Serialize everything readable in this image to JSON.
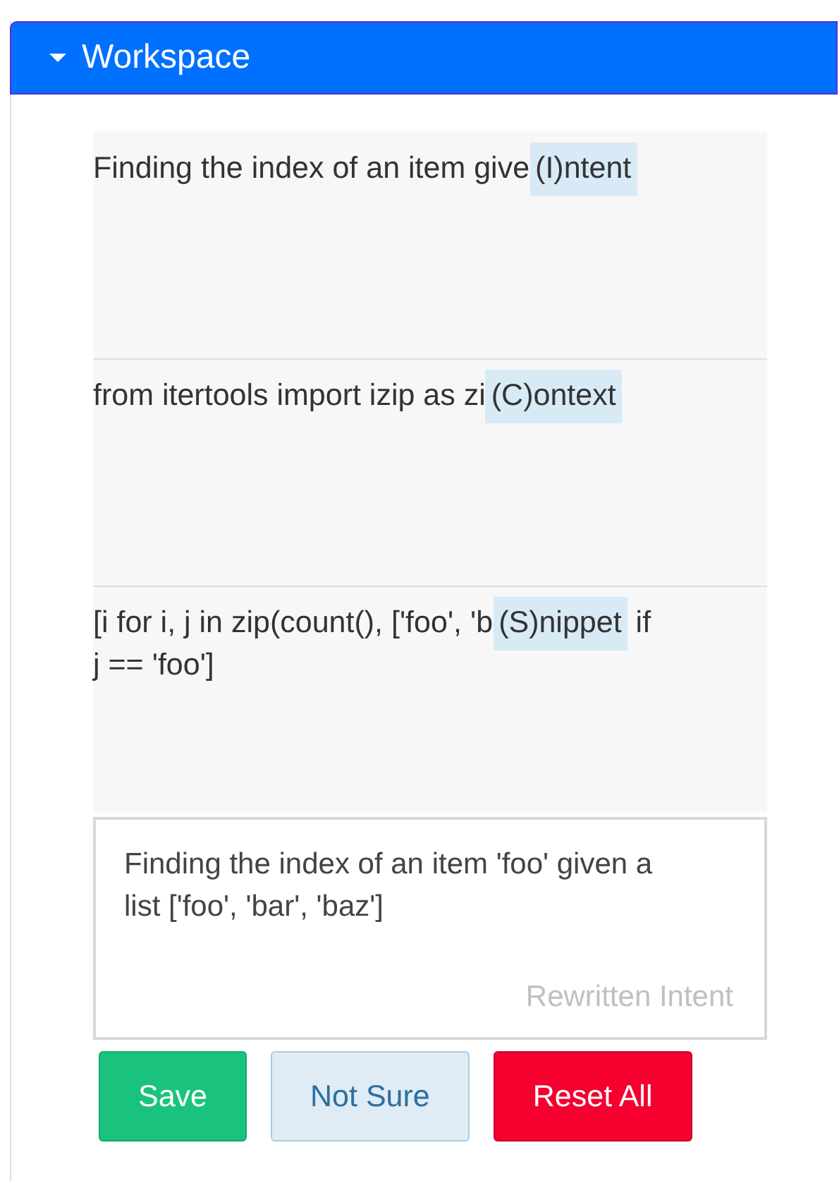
{
  "panel": {
    "title": "Workspace",
    "expanded": true
  },
  "sections": [
    {
      "text_before": "Finding the index of an item give",
      "tag": "(I)ntent"
    },
    {
      "text_before": "from itertools import izip as zi",
      "tag": "(C)ontext"
    },
    {
      "text_before": "[i for i, j in zip(count(), ['foo', 'b",
      "tag": "(S)nippet",
      "text_after": [
        "if",
        "j == 'foo']"
      ]
    }
  ],
  "rewrite": {
    "value": "Finding the index of an item 'foo' given a list ['foo', 'bar', 'baz']",
    "label": "Rewritten Intent"
  },
  "buttons": [
    {
      "label": "Save",
      "kind": "success"
    },
    {
      "label": "Not Sure",
      "kind": "info"
    },
    {
      "label": "Reset All",
      "kind": "danger"
    }
  ]
}
